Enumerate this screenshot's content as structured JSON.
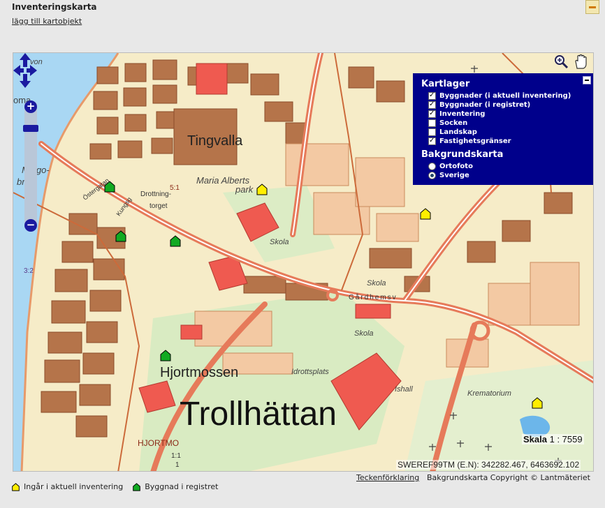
{
  "panel": {
    "title": "Inventeringskarta",
    "add_link": "lägg till kartobjekt"
  },
  "colors": {
    "map_bg": "#f6ecc8",
    "building": "#b5744a",
    "block": "#f3c9a3",
    "road": "#e67a5a",
    "water": "#a9d7f3",
    "park": "#d9ebc2",
    "layer_panel": "#00008b",
    "marker_inventory": "#ffee00",
    "marker_registry": "#11aa22"
  },
  "map": {
    "labels": {
      "tingvalla": "Tingvalla",
      "maria_alberts": "Maria Alberts",
      "park": "park",
      "drottning": "Drottning-",
      "torget": "torget",
      "skola1": "Skola",
      "skola2": "Skola",
      "skola3": "Skola",
      "gardhemsv": "Gårdhemsv",
      "hjortmossen": "Hjortmossen",
      "idrottsplats": "Idrottsplats",
      "ishall": "Ishall",
      "krematorium": "Krematorium",
      "trollhattan": "Trollhättan",
      "hjortmo": "HJORTMO",
      "ratio_1_1": "1:1",
      "one": "1",
      "ratio_5_1": "5:1",
      "ratio_3_2": "3:2",
      "malgo": "Malgo-",
      "bron": "bron",
      "ostergatan": "Östergatan",
      "kungsg": "Kungsg",
      "von": "von",
      "oma": "oma"
    },
    "scale": {
      "label": "Skala",
      "value": "1 : 7559"
    },
    "coordinates": "SWEREF99TM (E.N): 342282.467, 6463692.102"
  },
  "layers_panel": {
    "title": "Kartlager",
    "layers": [
      {
        "label": "Byggnader (i aktuell inventering)",
        "checked": true
      },
      {
        "label": "Byggnader (i registret)",
        "checked": true
      },
      {
        "label": "Inventering",
        "checked": true
      },
      {
        "label": "Socken",
        "checked": false
      },
      {
        "label": "Landskap",
        "checked": false
      },
      {
        "label": "Fastighetsgränser",
        "checked": true
      }
    ],
    "bg_title": "Bakgrundskarta",
    "bg_options": [
      {
        "label": "Ortofoto",
        "selected": false
      },
      {
        "label": "Sverige",
        "selected": true
      }
    ]
  },
  "footer": {
    "legend_link": "Teckenförklaring",
    "copyright": "Bakgrundskarta Copyright © Lantmäteriet",
    "legend_items": [
      {
        "label": "Ingår i aktuell inventering",
        "color": "#ffee00"
      },
      {
        "label": "Byggnad i registret",
        "color": "#11aa22"
      }
    ]
  }
}
